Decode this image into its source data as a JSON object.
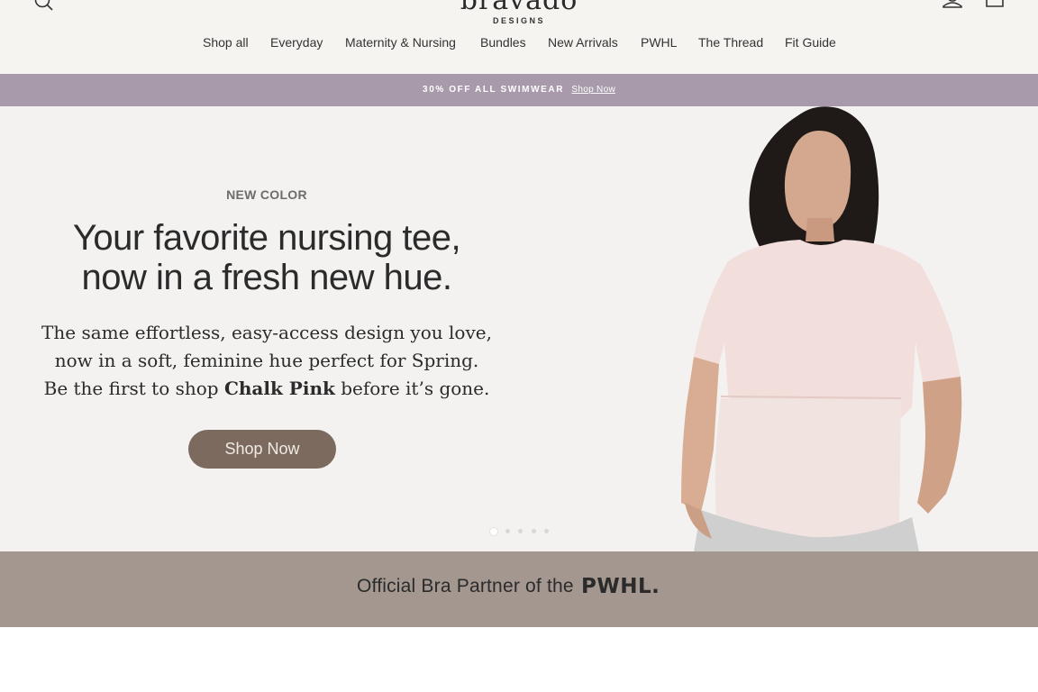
{
  "header": {
    "logo": {
      "word": "bravado",
      "sub": "DESIGNS"
    },
    "nav": [
      {
        "label": "Shop all"
      },
      {
        "label": "Everyday"
      },
      {
        "label": "Maternity & Nursing"
      },
      {
        "label": "Bundles"
      },
      {
        "label": "New Arrivals"
      },
      {
        "label": "PWHL"
      },
      {
        "label": "The Thread"
      },
      {
        "label": "Fit Guide"
      }
    ],
    "icons": {
      "search": "search-icon",
      "account": "account-icon",
      "cart": "cart-icon"
    }
  },
  "promo": {
    "text": "30% OFF ALL SWIMWEAR",
    "link": "Shop Now"
  },
  "hero": {
    "eyebrow": "NEW COLOR",
    "headline": [
      "Your favorite nursing tee,",
      "now in a fresh new hue."
    ],
    "sub_line1": "The same effortless, easy-access design you love,",
    "sub_line2": "now in a soft, feminine hue perfect for Spring.",
    "sub_line3_pre": "Be the first to shop",
    "sub_line3_bold": "Chalk Pink",
    "sub_line3_post": "before it’s gone.",
    "cta": "Shop Now",
    "slides": 5,
    "active_slide": 1
  },
  "partner": {
    "text": "Official Bra Partner of the",
    "brand": "PWHL",
    "brand_dot": "."
  },
  "colors": {
    "header_bg": "#f6f4f1",
    "promo_bg": "#a89aab",
    "hero_bg": "#f3f2f0",
    "cta_bg": "#7b6a5d",
    "partner_bg": "#a39790"
  }
}
